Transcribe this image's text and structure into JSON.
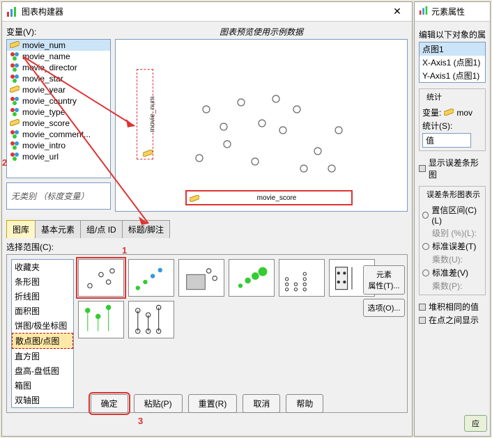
{
  "dialog": {
    "title": "图表构建器",
    "var_label": "变量(V):",
    "variables": [
      {
        "name": "movie_num",
        "type": "ruler",
        "selected": true
      },
      {
        "name": "movie_name",
        "type": "nominal"
      },
      {
        "name": "movie_director",
        "type": "nominal"
      },
      {
        "name": "movie_star",
        "type": "nominal"
      },
      {
        "name": "movie_year",
        "type": "ruler"
      },
      {
        "name": "movie_country",
        "type": "nominal"
      },
      {
        "name": "movie_type",
        "type": "nominal"
      },
      {
        "name": "movie_score",
        "type": "ruler"
      },
      {
        "name": "movie_comment...",
        "type": "nominal"
      },
      {
        "name": "movie_intro",
        "type": "nominal"
      },
      {
        "name": "movie_url",
        "type": "nominal"
      }
    ],
    "no_category": "无类别 （标度变量）",
    "preview_label": "图表预览使用示例数据",
    "drop_y": "movie_num",
    "drop_x": "movie_score",
    "tabs": [
      "图库",
      "基本元素",
      "组/点 ID",
      "标题/脚注"
    ],
    "active_tab": 0,
    "scope_label": "选择范围(C):",
    "chart_types": [
      "收藏夹",
      "条形图",
      "折线图",
      "面积图",
      "饼图/极坐标图",
      "散点图/点图",
      "直方图",
      "盘高-盘低图",
      "箱图",
      "双轴图"
    ],
    "selected_type_index": 5,
    "side_buttons": {
      "elem_props": "元素\n属性(T)...",
      "options": "选项(O)..."
    },
    "footer": {
      "ok": "确定",
      "paste": "粘贴(P)",
      "reset": "重置(R)",
      "cancel": "取消",
      "help": "帮助"
    },
    "markers": {
      "m1": "1",
      "m2": "2",
      "m3": "3"
    }
  },
  "right_panel": {
    "title": "元素属性",
    "edit_label": "编辑以下对象的属",
    "obj_list": [
      "点图1",
      "X-Axis1 (点图1)",
      "Y-Axis1 (点图1)"
    ],
    "selected_obj": 0,
    "stats_group": "统计",
    "var_label": "变量:",
    "var_value": "mov",
    "stat_label": "统计(S):",
    "stat_value": "值",
    "show_error": "显示误差条形图",
    "error_group": "误差条形图表示",
    "ci": "置信区间(C)(L)",
    "level": "级别 (%)(L):",
    "se": "标准误差(T)",
    "mult1": "乘数(U):",
    "sd": "标准差(V)",
    "mult2": "乘数(P):",
    "stack": "堆积相同的值",
    "showlbl": "在点之间显示",
    "apply": "应"
  }
}
